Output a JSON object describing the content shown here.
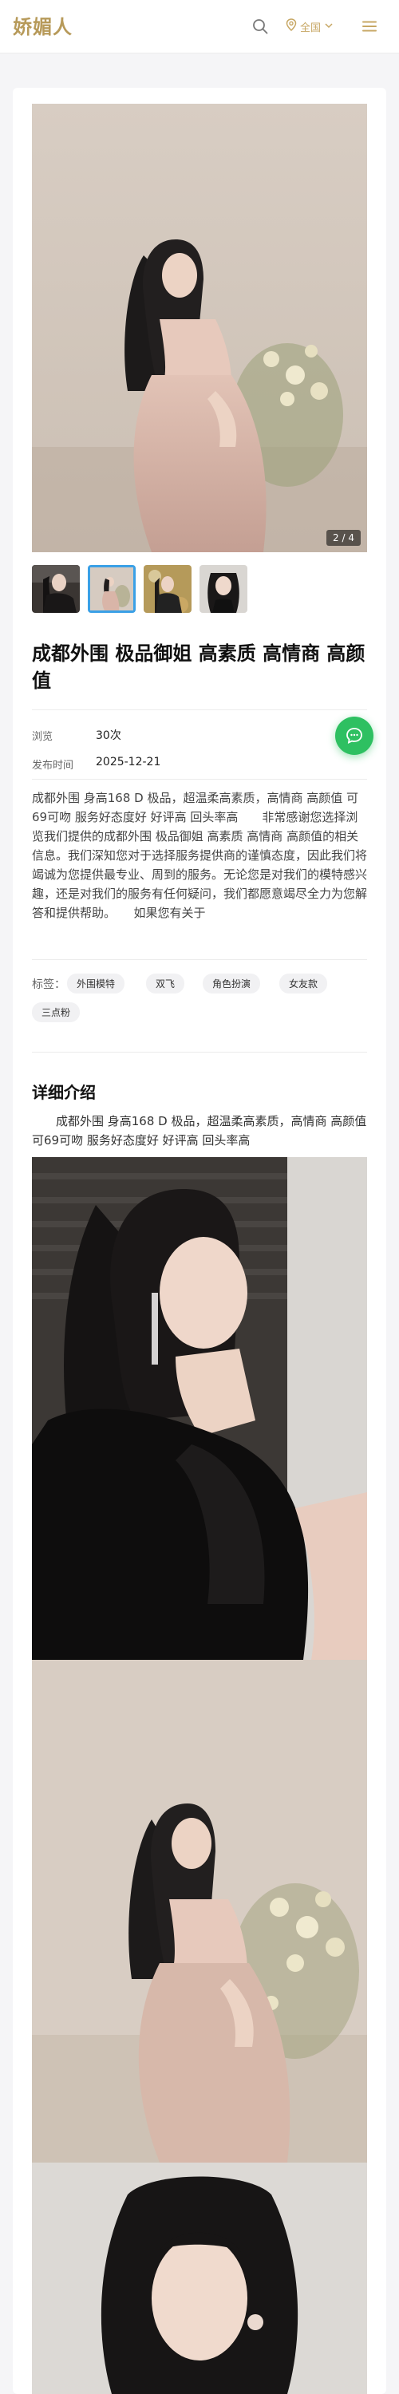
{
  "header": {
    "logo": "娇媚人",
    "city": "全国",
    "icons": [
      "search-icon",
      "location-pin-icon",
      "chevron-down-icon",
      "menu-icon"
    ],
    "accent_color": "#c7a764"
  },
  "gallery": {
    "counter": "2 / 4",
    "thumbnails": [
      "photo-black-dress",
      "photo-pink-dress",
      "photo-gold-dress",
      "photo-portrait"
    ],
    "active_index": 1
  },
  "post": {
    "title": "成都外围 极品御姐 高素质 高情商 高颜值",
    "views_label": "浏览",
    "views_value": "30次",
    "date_label": "发布时间",
    "date_value": "2025-12-21",
    "description": "成都外围 身高168 D 极品，超温柔高素质，高情商 高颜值 可69可吻 服务好态度好 好评高 回头率高　　非常感谢您选择浏览我们提供的成都外围 极品御姐 高素质 高情商 高颜值的相关信息。我们深知您对于选择服务提供商的谨慎态度，因此我们将竭诚为您提供最专业、周到的服务。无论您是对我们的模特感兴趣，还是对我们的服务有任何疑问，我们都愿意竭尽全力为您解答和提供帮助。　　如果您有关于",
    "tags_label": "标签：",
    "tags": [
      "外围模特",
      "双飞",
      "角色扮演",
      "女友款",
      "三点粉"
    ]
  },
  "detail": {
    "section_title": "详细介绍",
    "text": "成都外围 身高168 D 极品，超温柔高素质，高情商 高颜值 可69可吻 服务好态度好 好评高 回头率高"
  },
  "fab": {
    "icon": "chat-bubble-icon",
    "color": "#2ec061"
  }
}
